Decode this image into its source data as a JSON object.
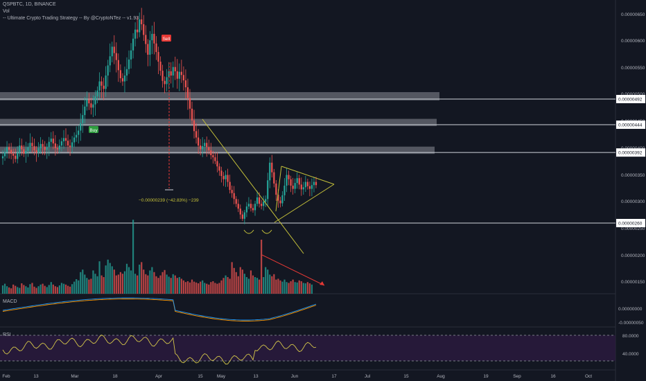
{
  "header": {
    "symbol_line": "QSPBTC, 1D, BINANCE",
    "vol_label": "Vol",
    "strategy_label": "-- Ultimate Crypto Trading Strategy -- By @CryptoNTez -- v1.93"
  },
  "panes": {
    "macd_label": "MACD",
    "rsi_label": "RSI"
  },
  "colors": {
    "background": "#131722",
    "up_candle": "#26a69a",
    "down_candle": "#ef5350",
    "zone": "#8a8d96",
    "trendline": "#c6c23a",
    "macd_line": "#2196f3",
    "signal_line": "#ff9800",
    "rsi_line": "#d6c84a",
    "rsi_band": "#2a1a3d",
    "sell_signal": "#e53935",
    "buy_signal": "#2e9e3e"
  },
  "annotations": {
    "sell": "Sell",
    "buy": "Buy",
    "measure": "−0.00000239 (−42.83%) −239"
  },
  "chart_data": {
    "type": "candlestick",
    "title": "QSPBTC, 1D, BINANCE",
    "x_ticks": [
      "Feb",
      "13",
      "Mar",
      "18",
      "Apr",
      "15",
      "May",
      "13",
      "Jun",
      "17",
      "Jul",
      "15",
      "Aug",
      "19",
      "Sep",
      "16",
      "Oct"
    ],
    "y_ticks": [
      "0.00000650",
      "0.00000600",
      "0.00000550",
      "0.00000500",
      "0.00000450",
      "0.00000400",
      "0.00000350",
      "0.00000300",
      "0.00000250",
      "0.00000200",
      "0.00000150"
    ],
    "macd_ticks": [
      "0.00000000",
      "-0.00000050"
    ],
    "rsi_ticks": [
      "80.0000",
      "40.0000"
    ],
    "price_labels": [
      "0.00000492",
      "0.00000444",
      "0.00000392",
      "0.00000260"
    ],
    "horizontal_levels": [
      4.92e-06,
      4.44e-06,
      3.92e-06,
      2.6e-06
    ],
    "resistance_zones": [
      {
        "low": 4.92e-06,
        "high": 5.05e-06
      },
      {
        "low": 4.44e-06,
        "high": 4.55e-06
      },
      {
        "low": 3.92e-06,
        "high": 4.03e-06
      }
    ],
    "closes": [
      3.85e-06,
      3.93e-06,
      4.02e-06,
      3.97e-06,
      3.9e-06,
      3.86e-06,
      3.8e-06,
      3.92e-06,
      4.05e-06,
      3.98e-06,
      3.9e-06,
      3.95e-06,
      4.02e-06,
      4.1e-06,
      4.04e-06,
      3.96e-06,
      3.92e-06,
      4e-06,
      4.08e-06,
      4.03e-06,
      3.97e-06,
      4.02e-06,
      4.12e-06,
      4.18e-06,
      4.09e-06,
      4e-06,
      3.98e-06,
      4.05e-06,
      4.13e-06,
      4.19e-06,
      4.14e-06,
      4.05e-06,
      4.02e-06,
      4.11e-06,
      4.2e-06,
      4.25e-06,
      4.33e-06,
      4.47e-06,
      4.62e-06,
      4.78e-06,
      4.91e-06,
      4.84e-06,
      4.76e-06,
      4.82e-06,
      4.97e-06,
      5.08e-06,
      5.25e-06,
      5.17e-06,
      5.11e-06,
      5.36e-06,
      5.55e-06,
      5.72e-06,
      5.9e-06,
      5.78e-06,
      5.65e-06,
      5.46e-06,
      5.31e-06,
      5.25e-06,
      5.36e-06,
      5.48e-06,
      5.66e-06,
      5.83e-06,
      6.05e-06,
      6.22e-06,
      6.17e-06,
      6.41e-06,
      6.32e-06,
      6.12e-06,
      5.95e-06,
      5.75e-06,
      6.02e-06,
      6.14e-06,
      5.96e-06,
      5.8e-06,
      5.62e-06,
      5.45e-06,
      5.26e-06,
      5.2e-06,
      5.33e-06,
      5.44e-06,
      5.36e-06,
      5.52e-06,
      5.44e-06,
      5.3e-06,
      5.43e-06,
      5.37e-06,
      5.27e-06,
      5.14e-06,
      4.94e-06,
      4.74e-06,
      4.52e-06,
      4.32e-06,
      4.2e-06,
      4.05e-06,
      3.98e-06,
      4.04e-06,
      4.1e-06,
      4.02e-06,
      3.96e-06,
      3.87e-06,
      3.83e-06,
      3.76e-06,
      3.66e-06,
      3.58e-06,
      3.48e-06,
      3.42e-06,
      3.5e-06,
      3.37e-06,
      3.22e-06,
      3.16e-06,
      3.05e-06,
      2.96e-06,
      2.87e-06,
      2.76e-06,
      2.68e-06,
      2.8e-06,
      2.91e-06,
      2.96e-06,
      2.88e-06,
      2.84e-06,
      2.96e-06,
      3.08e-06,
      2.96e-06,
      2.92e-06,
      3e-06,
      3.05e-06,
      3.4e-06,
      3.73e-06,
      3.55e-06,
      3.34e-06,
      3.13e-06,
      3.02e-06,
      2.97e-06,
      3.12e-06,
      3.3e-06,
      3.5e-06,
      3.42e-06,
      3.3e-06,
      3.24e-06,
      3.35e-06,
      3.44e-06,
      3.32e-06,
      3.23e-06,
      3.27e-06,
      3.37e-06,
      3.29e-06,
      3.24e-06,
      3.31e-06,
      3.37e-06,
      3.31e-06
    ],
    "volumes": [
      20,
      24,
      18,
      15,
      13,
      22,
      19,
      16,
      14,
      25,
      21,
      18,
      15,
      23,
      26,
      17,
      14,
      18,
      22,
      24,
      19,
      16,
      21,
      28,
      22,
      18,
      16,
      20,
      26,
      24,
      22,
      19,
      17,
      23,
      29,
      35,
      32,
      52,
      58,
      46,
      38,
      34,
      36,
      56,
      48,
      42,
      78,
      44,
      40,
      68,
      82,
      74,
      66,
      58,
      44,
      46,
      52,
      48,
      54,
      72,
      64,
      56,
      178,
      48,
      44,
      70,
      76,
      58,
      47,
      44,
      56,
      64,
      52,
      42,
      38,
      44,
      52,
      57,
      46,
      41,
      38,
      47,
      44,
      38,
      40,
      36,
      32,
      28,
      30,
      27,
      34,
      29,
      27,
      25,
      29,
      32,
      26,
      24,
      22,
      28,
      30,
      26,
      24,
      26,
      32,
      38,
      44,
      40,
      36,
      76,
      62,
      52,
      42,
      64,
      58,
      48,
      40,
      36,
      56,
      44,
      40,
      38,
      34,
      130,
      40,
      64,
      58,
      46,
      42,
      47,
      34,
      36,
      32,
      29,
      34,
      28,
      26,
      30,
      34,
      28,
      27,
      32,
      30,
      26,
      25,
      28,
      25,
      22
    ],
    "sell_index": 68,
    "buy_index": 37
  }
}
